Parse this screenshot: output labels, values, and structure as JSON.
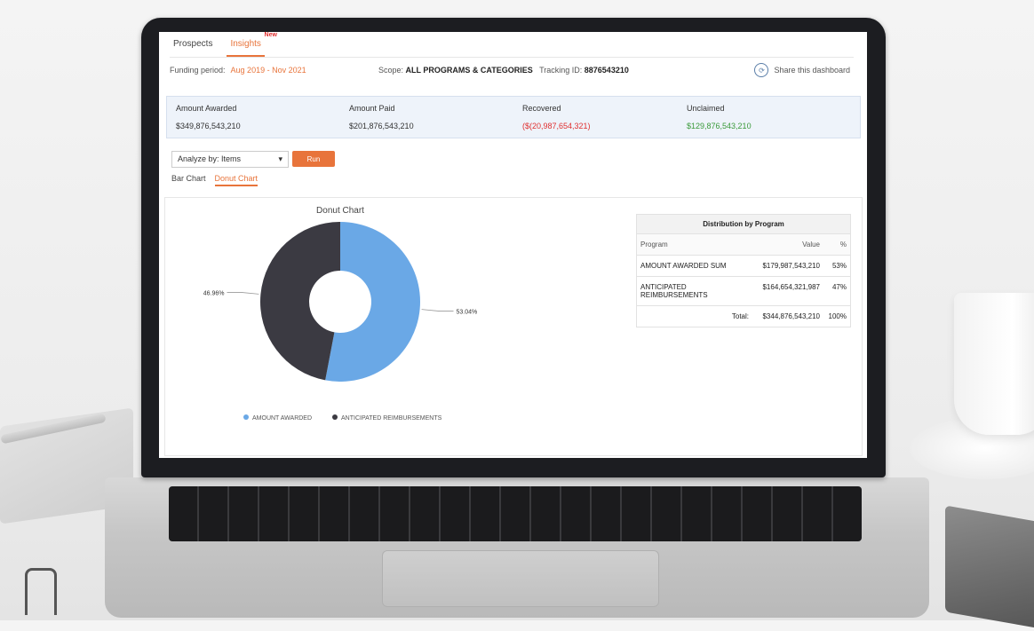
{
  "tabs": [
    {
      "label": "Prospects",
      "badge": ""
    },
    {
      "label": "Insights",
      "badge": "New"
    }
  ],
  "filters": {
    "period_label": "Funding period:",
    "period_value": "Aug 2019 - Nov 2021",
    "scope_label": "Scope:",
    "scope_value": "ALL PROGRAMS & CATEGORIES",
    "tracking_label": "Tracking ID:",
    "tracking_value": "8876543210",
    "share_label": "Share this dashboard"
  },
  "summary": {
    "items": [
      {
        "label": "Amount Awarded",
        "value": "$349,876,543,210"
      },
      {
        "label": "Amount Paid",
        "value": "$201,876,543,210"
      },
      {
        "label": "Recovered",
        "value": "($(20,987,654,321)"
      },
      {
        "label": "Unclaimed",
        "value": "$129,876,543,210"
      }
    ]
  },
  "controls": {
    "select_value": "Analyze by: Items",
    "run_label": "Run",
    "subtabs": [
      "Bar Chart",
      "Donut Chart"
    ]
  },
  "table": {
    "caption": "Distribution by Program",
    "headers": [
      "Program",
      "Value",
      "%"
    ],
    "rows": [
      {
        "name": "AMOUNT AWARDED SUM",
        "value": "$179,987,543,210",
        "pct": "53%"
      },
      {
        "name": "ANTICIPATED REIMBURSEMENTS",
        "value": "$164,654,321,987",
        "pct": "47%"
      },
      {
        "name": "Total:",
        "value": "$344,876,543,210",
        "pct": "100%"
      }
    ]
  },
  "chart_data": {
    "type": "pie",
    "title": "Donut Chart",
    "series": [
      {
        "name": "AMOUNT AWARDED",
        "value": 53,
        "color": "#6aa8e6"
      },
      {
        "name": "ANTICIPATED REIMBURSEMENTS",
        "value": 47,
        "color": "#3b3a42"
      }
    ],
    "data_labels": [
      "53.04%",
      "46.96%"
    ],
    "legend_position": "bottom",
    "hole": true
  }
}
